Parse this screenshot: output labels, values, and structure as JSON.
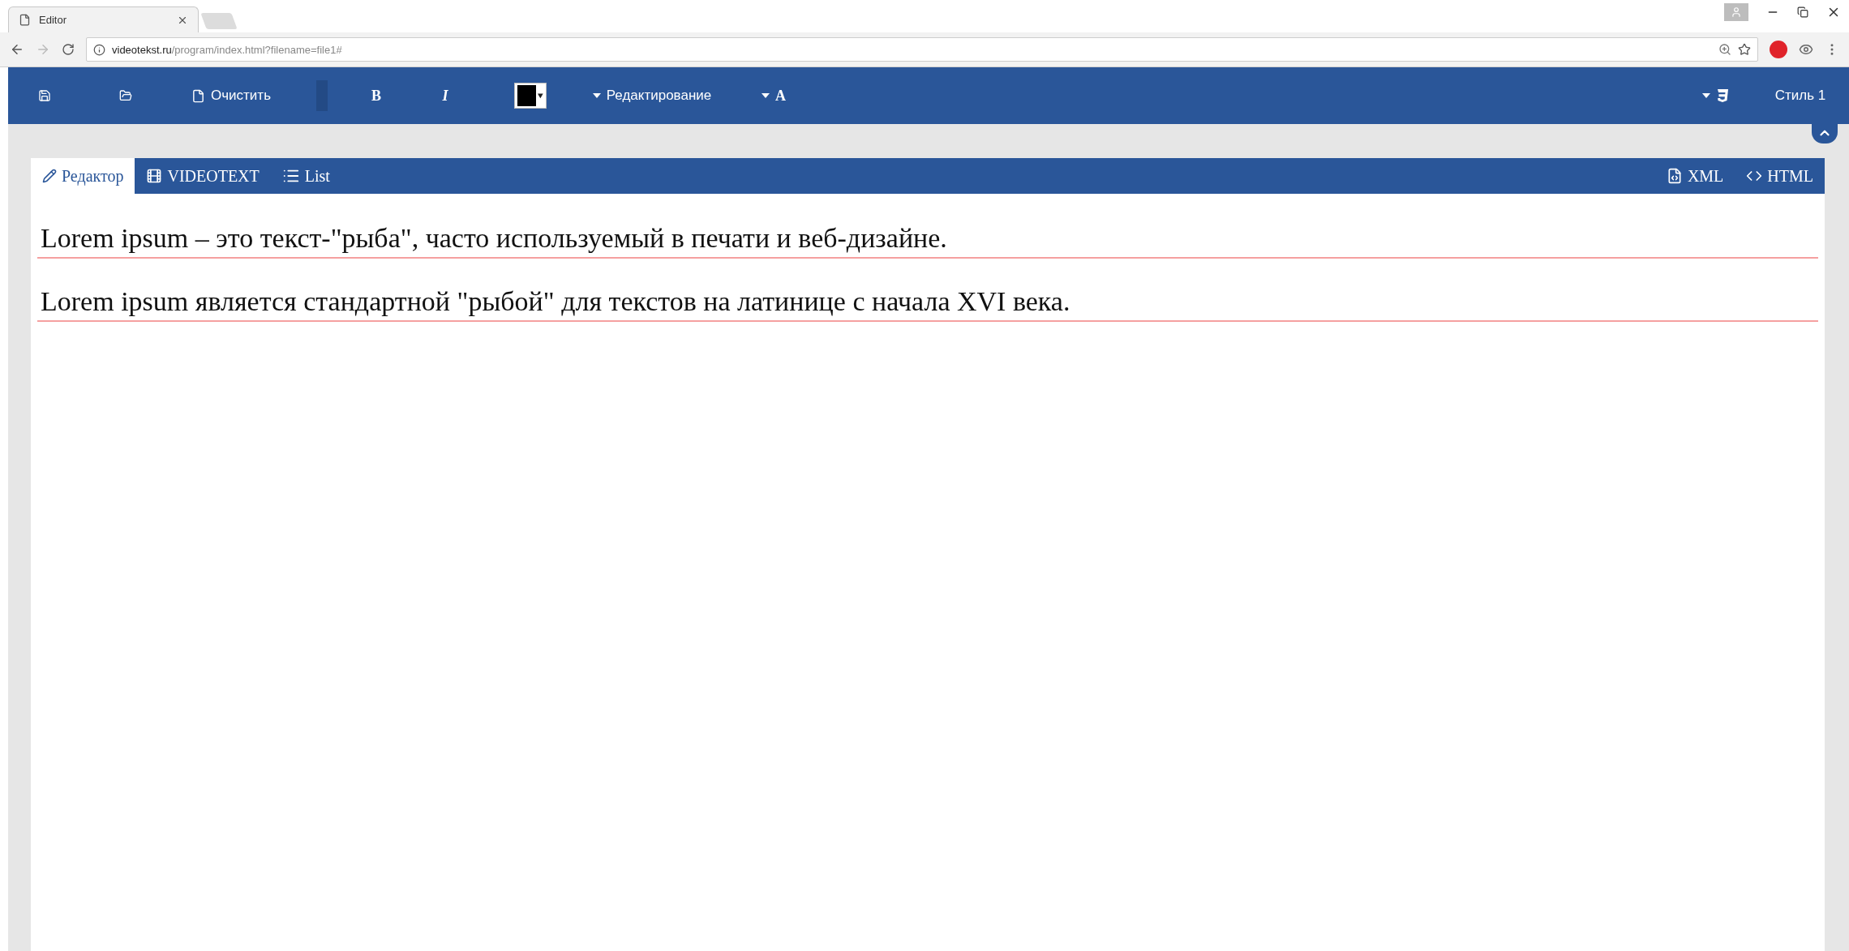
{
  "browser": {
    "tab_title": "Editor",
    "url": {
      "host": "videotekst.ru",
      "path": "/program/index.html?filename=file1#"
    }
  },
  "toolbar": {
    "clear_label": "Очистить",
    "bold_label": "B",
    "italic_label": "I",
    "editing_menu": "Редактирование",
    "font_menu": "A",
    "style_label": "Стиль 1"
  },
  "tabs": [
    {
      "label": "Редактор",
      "kind": "editor",
      "selected": true
    },
    {
      "label": "VIDEOTEXT",
      "kind": "video",
      "selected": false
    },
    {
      "label": "List",
      "kind": "list",
      "selected": false
    }
  ],
  "export_tabs": [
    {
      "label": "XML",
      "kind": "xml"
    },
    {
      "label": "HTML",
      "kind": "html"
    }
  ],
  "paragraphs": [
    "Lorem ipsum – это текст-\"рыба\", часто используемый в печати и веб-дизайне.",
    "Lorem ipsum является стандартной \"рыбой\" для текстов на латинице с начала XVI века."
  ]
}
